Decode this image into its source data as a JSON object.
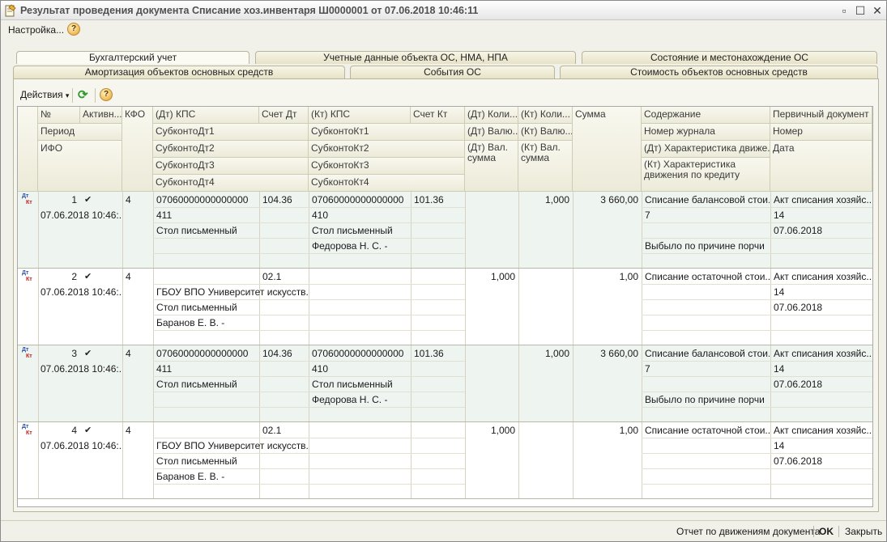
{
  "window": {
    "title": "Результат проведения документа Списание хоз.инвентаря Ш0000001 от 07.06.2018 10:46:11"
  },
  "menu": {
    "settings_label": "Настройка...",
    "help_glyph": "?"
  },
  "tabs_row1": [
    {
      "label": "Бухгалтерский учет",
      "active": true
    },
    {
      "label": "Учетные данные объекта ОС, НМА, НПА",
      "active": false
    },
    {
      "label": "Состояние и местонахождение ОС",
      "active": false
    }
  ],
  "tabs_row2": [
    {
      "label": "Амортизация объектов основных средств"
    },
    {
      "label": "События ОС"
    },
    {
      "label": "Стоимость объектов основных средств"
    }
  ],
  "toolbar": {
    "actions_label": "Действия",
    "dropdown_glyph": "▾",
    "refresh_glyph": "⟳",
    "help_glyph": "?"
  },
  "columns": {
    "num": "№",
    "active": "Активн...",
    "period": "Период",
    "ifo": "ИФО",
    "kfo": "КФО",
    "dt_kps": "(Дт) КПС",
    "dt_sub1": "СубконтоДт1",
    "dt_sub2": "СубконтоДт2",
    "dt_sub3": "СубконтоДт3",
    "dt_sub4": "СубконтоДт4",
    "dt_account": "Счет Дт",
    "kt_kps": "(Кт) КПС",
    "kt_sub1": "СубконтоКт1",
    "kt_sub2": "СубконтоКт2",
    "kt_sub3": "СубконтоКт3",
    "kt_sub4": "СубконтоКт4",
    "kt_account": "Счет Кт",
    "dt_qty": "(Дт) Коли...",
    "dt_cur": "(Дт) Валю...",
    "dt_cur_sum": "(Дт) Вал. сумма",
    "kt_qty": "(Кт) Коли...",
    "kt_cur": "(Кт) Валю...",
    "kt_cur_sum": "(Кт) Вал. сумма",
    "sum": "Сумма",
    "content": "Содержание",
    "journal": "Номер журнала",
    "dt_move": "(Дт) Характеристика движе...",
    "kt_move": "(Кт) Характеристика движения по кредиту",
    "primary_doc": "Первичный документ",
    "doc_num": "Номер",
    "doc_date": "Дата"
  },
  "rows": [
    {
      "dt_label": "Дт",
      "kt_label": "Кт",
      "num": "1",
      "active": "✔",
      "period": "07.06.2018 10:46:...",
      "kfo": "4",
      "dt_kps": "07060000000000000",
      "dt_sub1": "411",
      "dt_sub2": "Стол письменный",
      "dt_sub3": "",
      "dt_account": "104.36",
      "kt_kps": "07060000000000000",
      "kt_sub1": "410",
      "kt_sub2": "Стол письменный",
      "kt_sub3": "Федорова Н. С. -",
      "kt_account": "101.36",
      "dt_qty": "",
      "kt_qty": "1,000",
      "sum": "3 660,00",
      "content": "Списание балансовой стои...",
      "journal": "7",
      "dt_move": "",
      "kt_move": "Выбыло по причине порчи",
      "primary_doc": "Акт списания хозяйс...",
      "doc_num": "14",
      "doc_date": "07.06.2018",
      "shaded": true
    },
    {
      "dt_label": "Дт",
      "kt_label": "Кт",
      "num": "2",
      "active": "✔",
      "period": "07.06.2018 10:46:...",
      "kfo": "4",
      "dt_kps": "",
      "dt_sub1": "ГБОУ ВПО Университет искусств...",
      "dt_sub2": "Стол письменный",
      "dt_sub3": "Баранов Е. В. -",
      "dt_account": "02.1",
      "kt_kps": "",
      "kt_sub1": "",
      "kt_sub2": "",
      "kt_sub3": "",
      "kt_account": "",
      "dt_qty": "1,000",
      "kt_qty": "",
      "sum": "1,00",
      "content": "Списание остаточной стои...",
      "journal": "",
      "dt_move": "",
      "kt_move": "",
      "primary_doc": "Акт списания хозяйс...",
      "doc_num": "14",
      "doc_date": "07.06.2018",
      "shaded": false
    },
    {
      "dt_label": "Дт",
      "kt_label": "Кт",
      "num": "3",
      "active": "✔",
      "period": "07.06.2018 10:46:...",
      "kfo": "4",
      "dt_kps": "07060000000000000",
      "dt_sub1": "411",
      "dt_sub2": "Стол письменный",
      "dt_sub3": "",
      "dt_account": "104.36",
      "kt_kps": "07060000000000000",
      "kt_sub1": "410",
      "kt_sub2": "Стол письменный",
      "kt_sub3": "Федорова Н. С. -",
      "kt_account": "101.36",
      "dt_qty": "",
      "kt_qty": "1,000",
      "sum": "3 660,00",
      "content": "Списание балансовой стои...",
      "journal": "7",
      "dt_move": "",
      "kt_move": "Выбыло по причине порчи",
      "primary_doc": "Акт списания хозяйс...",
      "doc_num": "14",
      "doc_date": "07.06.2018",
      "shaded": true
    },
    {
      "dt_label": "Дт",
      "kt_label": "Кт",
      "num": "4",
      "active": "✔",
      "period": "07.06.2018 10:46:...",
      "kfo": "4",
      "dt_kps": "",
      "dt_sub1": "ГБОУ ВПО Университет искусств...",
      "dt_sub2": "Стол письменный",
      "dt_sub3": "Баранов Е. В. -",
      "dt_account": "02.1",
      "kt_kps": "",
      "kt_sub1": "",
      "kt_sub2": "",
      "kt_sub3": "",
      "kt_account": "",
      "dt_qty": "1,000",
      "kt_qty": "",
      "sum": "1,00",
      "content": "Списание остаточной стои...",
      "journal": "",
      "dt_move": "",
      "kt_move": "",
      "primary_doc": "Акт списания хозяйс...",
      "doc_num": "14",
      "doc_date": "07.06.2018",
      "shaded": false
    }
  ],
  "footer": {
    "report_label": "Отчет по движениям документа",
    "ok_label": "OK",
    "close_label": "Закрыть"
  },
  "colors": {
    "row_shade": "#eef5f1",
    "row_plain": "#ffffff"
  }
}
